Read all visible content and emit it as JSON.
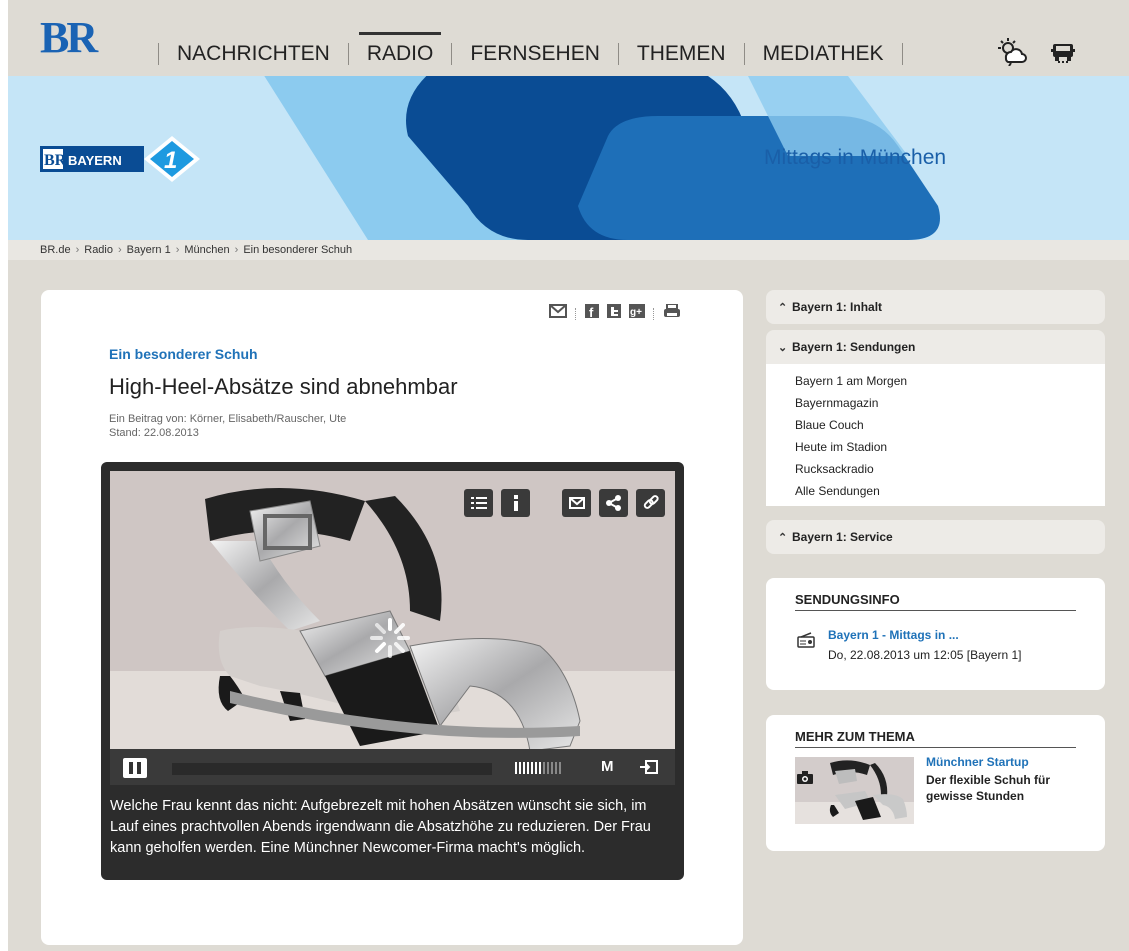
{
  "brand": {
    "logo_text": "BR"
  },
  "nav": {
    "items": [
      {
        "label": "NACHRICHTEN",
        "active": false
      },
      {
        "label": "RADIO",
        "active": true
      },
      {
        "label": "FERNSEHEN",
        "active": false
      },
      {
        "label": "THEMEN",
        "active": false
      },
      {
        "label": "MEDIATHEK",
        "active": false
      }
    ],
    "icons": [
      "weather-icon",
      "traffic-icon"
    ]
  },
  "banner": {
    "station_logo": "BR BAYERN 1",
    "show_title": "Mittags in München",
    "colors": {
      "light": "#c5e5f7",
      "mid": "#5fb3e4",
      "dark": "#0a4c94"
    }
  },
  "breadcrumb": [
    "BR.de",
    "Radio",
    "Bayern 1",
    "München",
    "Ein besonderer Schuh"
  ],
  "article": {
    "kicker": "Ein besonderer Schuh",
    "headline": "High-Heel-Absätze sind abnehmbar",
    "author": "Ein Beitrag von: Körner, Elisabeth/Rauscher, Ute",
    "date": "Stand: 22.08.2013",
    "share_icons": [
      "mail-icon",
      "facebook-icon",
      "twitter-icon",
      "google-plus-icon",
      "print-icon"
    ],
    "player": {
      "quality_label": "M",
      "caption": "Welche Frau kennt das nicht: Aufgebrezelt mit hohen Absätzen wünscht sie sich, im Lauf eines prachtvollen Abends irgendwann die Absatzhöhe zu reduzieren. Der Frau kann geholfen werden. Eine Münchner Newcomer-Firma macht's möglich.",
      "volume_level": 0.6
    }
  },
  "sidebar": {
    "sections": [
      {
        "label": "Bayern 1: Inhalt",
        "expanded": false
      },
      {
        "label": "Bayern 1: Sendungen",
        "expanded": true,
        "items": [
          "Bayern 1 am Morgen",
          "Bayernmagazin",
          "Blaue Couch",
          "Heute im Stadion",
          "Rucksackradio",
          "Alle Sendungen"
        ]
      },
      {
        "label": "Bayern 1: Service",
        "expanded": false
      }
    ],
    "sendungsinfo": {
      "title": "SENDUNGSINFO",
      "link": "Bayern 1 - Mittags in ...",
      "time": "Do, 22.08.2013 um 12:05 [Bayern 1]"
    },
    "mehr": {
      "title": "MEHR ZUM THEMA",
      "kicker": "Münchner Startup",
      "headline": "Der flexible Schuh für gewisse Stunden"
    }
  },
  "accent": "#1f72b8"
}
